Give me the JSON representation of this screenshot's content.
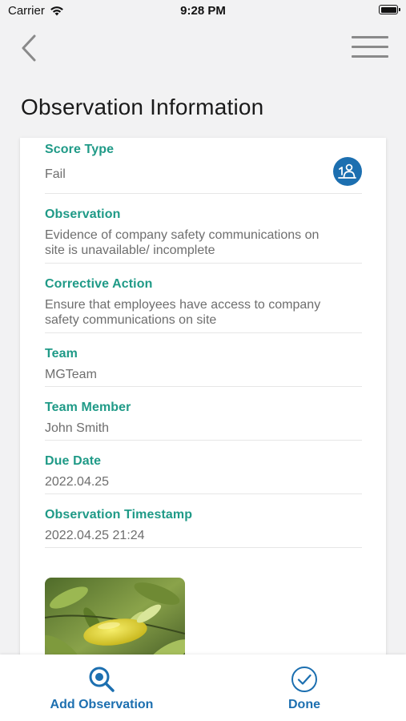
{
  "status_bar": {
    "carrier": "Carrier",
    "time": "9:28 PM",
    "wifi_icon": "wifi-icon",
    "battery_icon": "battery-icon"
  },
  "nav": {
    "back_icon": "chevron-left-icon",
    "menu_icon": "hamburger-menu-icon"
  },
  "page": {
    "title": "Observation Information"
  },
  "fields": {
    "score_type": {
      "label": "Score Type",
      "value": "Fail"
    },
    "observation": {
      "label": "Observation",
      "value_line1": "Evidence of company safety communications on",
      "value_line2": "site is unavailable/ incomplete"
    },
    "corrective_action": {
      "label": "Corrective Action",
      "value_line1": "Ensure that employees have access to company",
      "value_line2": "safety communications on site"
    },
    "team": {
      "label": "Team",
      "value": "MGTeam"
    },
    "team_member": {
      "label": "Team Member",
      "value": "John Smith"
    },
    "due_date": {
      "label": "Due Date",
      "value": "2022.04.25"
    },
    "observation_timestamp": {
      "label": "Observation Timestamp",
      "value": "2022.04.25 21:24"
    }
  },
  "bottom_bar": {
    "add_observation": {
      "label": "Add Observation",
      "icon": "magnifier-add-icon"
    },
    "done": {
      "label": "Done",
      "icon": "check-circle-icon"
    }
  },
  "colors": {
    "label_teal": "#1f9a87",
    "accent_blue": "#1c6fb0",
    "value_gray": "#6e6e6e",
    "background": "#f2f2f3"
  }
}
